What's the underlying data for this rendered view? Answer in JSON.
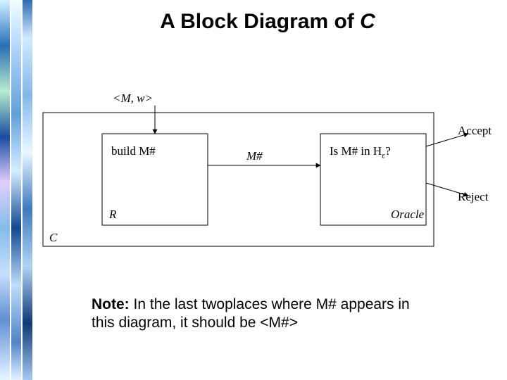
{
  "title_prefix": "A Block Diagram of ",
  "title_ital": "C",
  "diagram": {
    "input_label": "<M, w>",
    "box1_main": "build M#",
    "box1_sub": "R",
    "mid_arrow_label": "M#",
    "box2_main": "Is M# in H",
    "box2_sub_eps": "ε",
    "box2_tail": "?",
    "box2_footer": "Oracle",
    "out_accept": "Accept",
    "out_reject": "Reject",
    "outer_label": "C"
  },
  "note_bold": "Note:",
  "note_text": "  In the last twoplaces where M# appears in this diagram, it should be <M#>"
}
